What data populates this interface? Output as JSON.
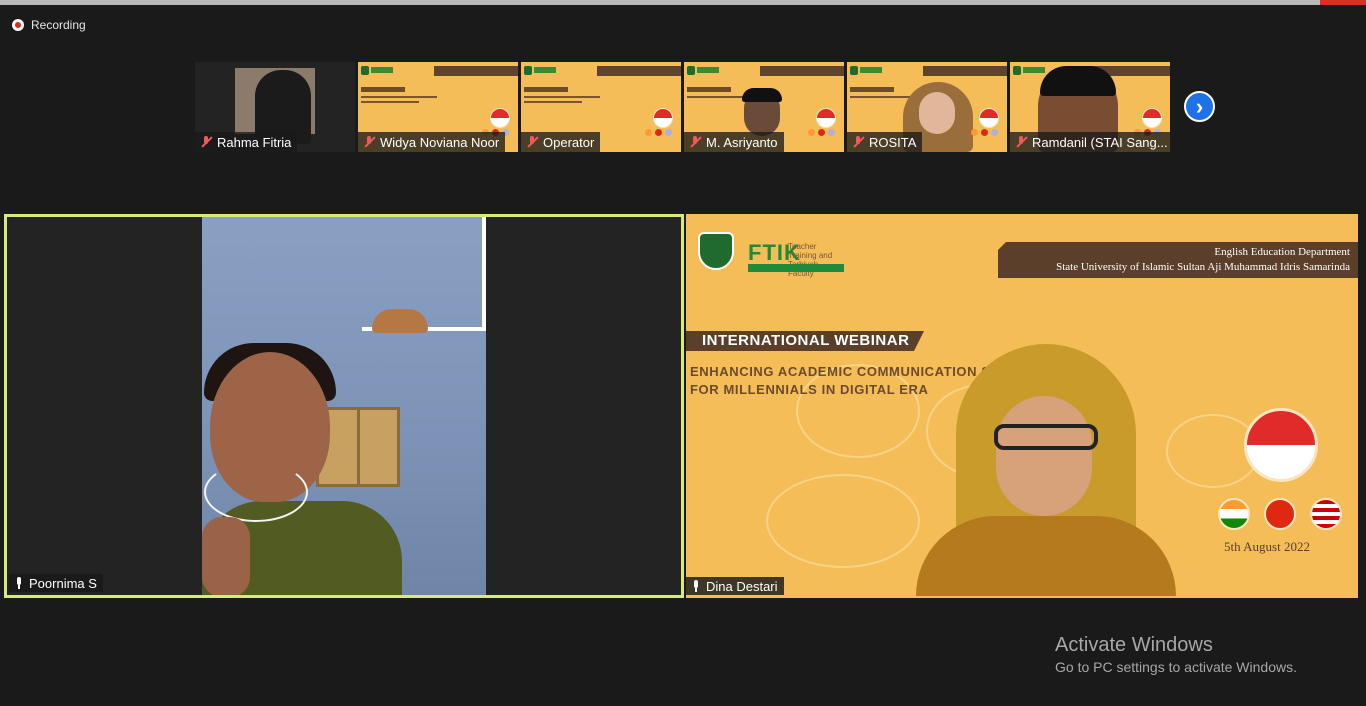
{
  "recording": {
    "label": "Recording"
  },
  "thumbnails": [
    {
      "name": "Rahma Fitria",
      "kind": "camera"
    },
    {
      "name": "Widya Noviana Noor",
      "kind": "slide"
    },
    {
      "name": "Operator",
      "kind": "slide"
    },
    {
      "name": "M. Asriyanto",
      "kind": "slide-person"
    },
    {
      "name": "ROSITA",
      "kind": "slide-person"
    },
    {
      "name": "Ramdanil (STAI Sang...",
      "kind": "slide-person"
    }
  ],
  "next_button": {
    "icon": "chevron-right-icon"
  },
  "main_tiles": {
    "left": {
      "name": "Poornima S",
      "active_speaker": true
    },
    "right": {
      "name": "Dina Destari"
    }
  },
  "slide": {
    "ftik_logo": "FTIK",
    "ftik_sub": "Teacher Training and Tarbiyah Faculty",
    "dept_line1": "English Education Department",
    "dept_line2": "State University of Islamic Sultan Aji Muhammad Idris Samarinda",
    "webinar": "INTERNATIONAL WEBINAR",
    "topic_line1": "ENHANCING ACADEMIC COMMUNICATION SKILL",
    "topic_line2": "FOR MILLENNIALS IN DIGITAL ERA",
    "date": "5th August 2022"
  },
  "colors": {
    "accent_border": "#d5ec78",
    "slide_bg": "#f4bd58",
    "next_button": "#1d72e8"
  },
  "watermark": {
    "title": "Activate Windows",
    "subtitle": "Go to PC settings to activate Windows."
  }
}
